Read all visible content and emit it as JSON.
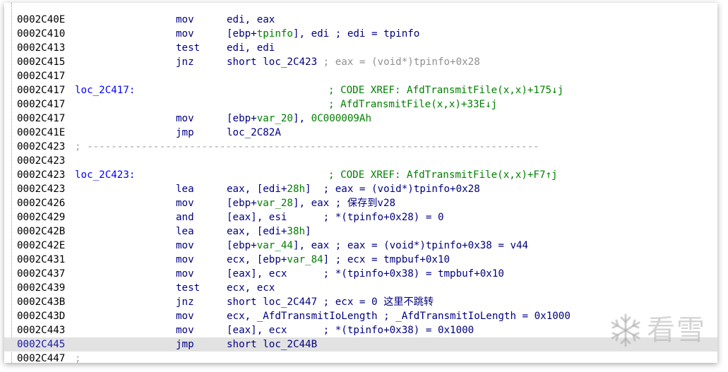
{
  "lines": [
    {
      "addr": "0002C40E",
      "mnem": "mov",
      "operands": [
        {
          "t": "edi, eax",
          "c": "n"
        }
      ]
    },
    {
      "addr": "0002C410",
      "mnem": "mov",
      "operands": [
        {
          "t": "[ebp+",
          "c": "n"
        },
        {
          "t": "tpinfo",
          "c": "v"
        },
        {
          "t": "], edi ; edi = tpinfo",
          "c": "n"
        }
      ]
    },
    {
      "addr": "0002C413",
      "mnem": "test",
      "operands": [
        {
          "t": "edi, edi",
          "c": "n"
        }
      ]
    },
    {
      "addr": "0002C415",
      "mnem": "jnz",
      "operands": [
        {
          "t": "short loc_2C423",
          "c": "n"
        },
        {
          "t": " ; eax = (void*)tpinfo+0x28",
          "c": "g"
        }
      ]
    },
    {
      "addr": "0002C417"
    },
    {
      "addr": "0002C417",
      "label": "loc_2C417:",
      "comment": "; CODE XREF: AfdTransmitFile(x,x)+175↓j"
    },
    {
      "addr": "0002C417",
      "comment": "; AfdTransmitFile(x,x)+33E↓j"
    },
    {
      "addr": "0002C417",
      "mnem": "mov",
      "operands": [
        {
          "t": "[ebp+",
          "c": "n"
        },
        {
          "t": "var_20",
          "c": "v"
        },
        {
          "t": "], ",
          "c": "n"
        },
        {
          "t": "0C000009Ah",
          "c": "v"
        }
      ]
    },
    {
      "addr": "0002C41E",
      "mnem": "jmp",
      "operands": [
        {
          "t": "loc_2C82A",
          "c": "n"
        }
      ]
    },
    {
      "addr": "0002C423",
      "separator": "; ---------------------------------------------------------------------------"
    },
    {
      "addr": "0002C423"
    },
    {
      "addr": "0002C423",
      "label": "loc_2C423:",
      "comment": "; CODE XREF: AfdTransmitFile(x,x)+F7↑j"
    },
    {
      "addr": "0002C423",
      "mnem": "lea",
      "operands": [
        {
          "t": "eax, [edi+",
          "c": "n"
        },
        {
          "t": "28h",
          "c": "v"
        },
        {
          "t": "]  ; eax = (void*)tpinfo+0x28",
          "c": "n"
        }
      ]
    },
    {
      "addr": "0002C426",
      "mnem": "mov",
      "operands": [
        {
          "t": "[ebp+",
          "c": "n"
        },
        {
          "t": "var_28",
          "c": "v"
        },
        {
          "t": "], eax ; 保存到v28",
          "c": "n"
        }
      ]
    },
    {
      "addr": "0002C429",
      "mnem": "and",
      "operands": [
        {
          "t": "[eax], esi      ; *(tpinfo+0x28) = 0",
          "c": "n"
        }
      ]
    },
    {
      "addr": "0002C42B",
      "mnem": "lea",
      "operands": [
        {
          "t": "eax, [edi+",
          "c": "n"
        },
        {
          "t": "38h",
          "c": "v"
        },
        {
          "t": "]",
          "c": "n"
        }
      ]
    },
    {
      "addr": "0002C42E",
      "mnem": "mov",
      "operands": [
        {
          "t": "[ebp+",
          "c": "n"
        },
        {
          "t": "var_44",
          "c": "v"
        },
        {
          "t": "], eax ; eax = (void*)tpinfo+0x38 = v44",
          "c": "n"
        }
      ]
    },
    {
      "addr": "0002C431",
      "mnem": "mov",
      "operands": [
        {
          "t": "ecx, [ebp+",
          "c": "n"
        },
        {
          "t": "var_84",
          "c": "v"
        },
        {
          "t": "] ; ecx = tmpbuf+0x10",
          "c": "n"
        }
      ]
    },
    {
      "addr": "0002C437",
      "mnem": "mov",
      "operands": [
        {
          "t": "[eax], ecx      ; *(tpinfo+0x38) = tmpbuf+0x10",
          "c": "n"
        }
      ]
    },
    {
      "addr": "0002C439",
      "mnem": "test",
      "operands": [
        {
          "t": "ecx, ecx",
          "c": "n"
        }
      ]
    },
    {
      "addr": "0002C43B",
      "mnem": "jnz",
      "operands": [
        {
          "t": "short loc_2C447 ; ecx = 0 这里不跳转",
          "c": "n"
        }
      ]
    },
    {
      "addr": "0002C43D",
      "mnem": "mov",
      "operands": [
        {
          "t": "ecx, _AfdTransmitIoLength ; _AfdTransmitIoLength = 0x1000",
          "c": "n"
        }
      ]
    },
    {
      "addr": "0002C443",
      "mnem": "mov",
      "operands": [
        {
          "t": "[eax], ecx      ; *(tpinfo+0x38) = 0x1000",
          "c": "n"
        }
      ]
    },
    {
      "addr": "0002C445",
      "mnem": "jmp",
      "operands": [
        {
          "t": "short loc_2C44B",
          "c": "n"
        }
      ],
      "current": true
    },
    {
      "addr": "0002C447",
      "separator": ";"
    }
  ],
  "watermark": {
    "text": "看雪",
    "icon": "snowflake-icon"
  },
  "colors": {
    "address": "#000000",
    "current_address": "#1a1aa8",
    "label": "#0000ff",
    "instruction": "#000080",
    "variable": "#008000",
    "comment": "#008000",
    "separator": "#a0a0a0",
    "highlight": "#e2e2e2"
  }
}
